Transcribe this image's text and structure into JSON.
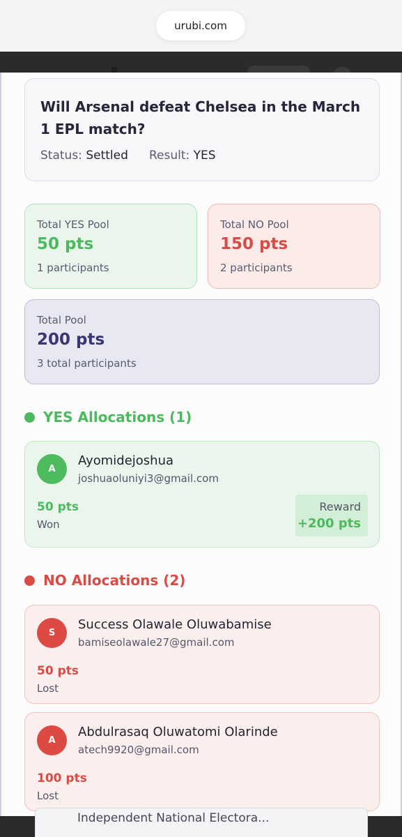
{
  "browser": {
    "url": "urubi.com"
  },
  "question": {
    "title": "Will Arsenal defeat Chelsea in the March 1 EPL match?",
    "status_label": "Status:",
    "status_value": "Settled",
    "result_label": "Result:",
    "result_value": "YES"
  },
  "pools": {
    "yes": {
      "label": "Total YES Pool",
      "value": "50 pts",
      "sub": "1 participants"
    },
    "no": {
      "label": "Total NO Pool",
      "value": "150 pts",
      "sub": "2 participants"
    },
    "total": {
      "label": "Total Pool",
      "value": "200 pts",
      "sub": "3 total participants"
    }
  },
  "yes_allocations": {
    "heading": "YES Allocations (1)",
    "items": [
      {
        "initial": "A",
        "name": "Ayomidejoshua",
        "email": "joshuaoluniyi3@gmail.com",
        "points": "50 pts",
        "outcome": "Won",
        "reward_label": "Reward",
        "reward_value": "+200 pts"
      }
    ]
  },
  "no_allocations": {
    "heading": "NO Allocations (2)",
    "items": [
      {
        "initial": "S",
        "name": "Success Olawale Oluwabamise",
        "email": "bamiseolawale27@gmail.com",
        "points": "50 pts",
        "outcome": "Lost"
      },
      {
        "initial": "A",
        "name": "Abdulrasaq Oluwatomi Olarinde",
        "email": "atech9920@gmail.com",
        "points": "100 pts",
        "outcome": "Lost"
      }
    ]
  },
  "background_peek": {
    "text": "Independent National Electora..."
  },
  "colors": {
    "yes": "#4db85f",
    "no": "#d94b45",
    "total": "#3a3575"
  }
}
